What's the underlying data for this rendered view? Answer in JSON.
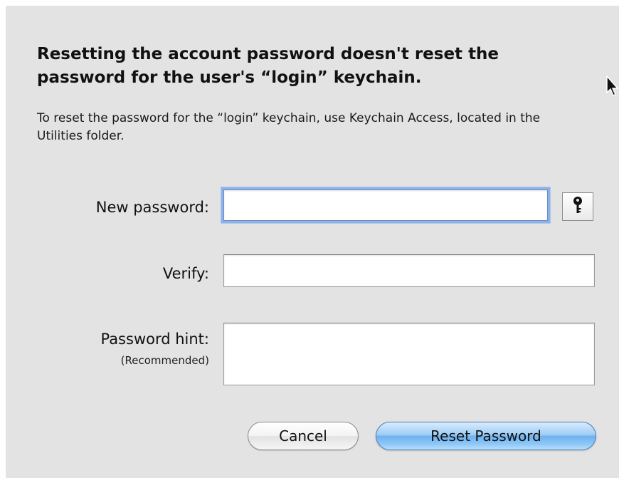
{
  "dialog": {
    "heading": "Resetting the account password doesn't reset the password for the user's “login” keychain.",
    "message": "To reset the password for the “login” keychain, use Keychain Access, located in the Utilities folder."
  },
  "form": {
    "new_password_label": "New password:",
    "new_password_value": "",
    "verify_label": "Verify:",
    "verify_value": "",
    "hint_label": "Password hint:",
    "hint_sublabel": "(Recommended)",
    "hint_value": ""
  },
  "buttons": {
    "cancel_label": "Cancel",
    "reset_label": "Reset Password"
  },
  "icons": {
    "password_assistant": "key-icon",
    "pointer": "mouse-pointer-icon"
  },
  "colors": {
    "background": "#e3e3e3",
    "focus_ring": "#8cb2e6",
    "default_button": "#6fb1ef"
  }
}
